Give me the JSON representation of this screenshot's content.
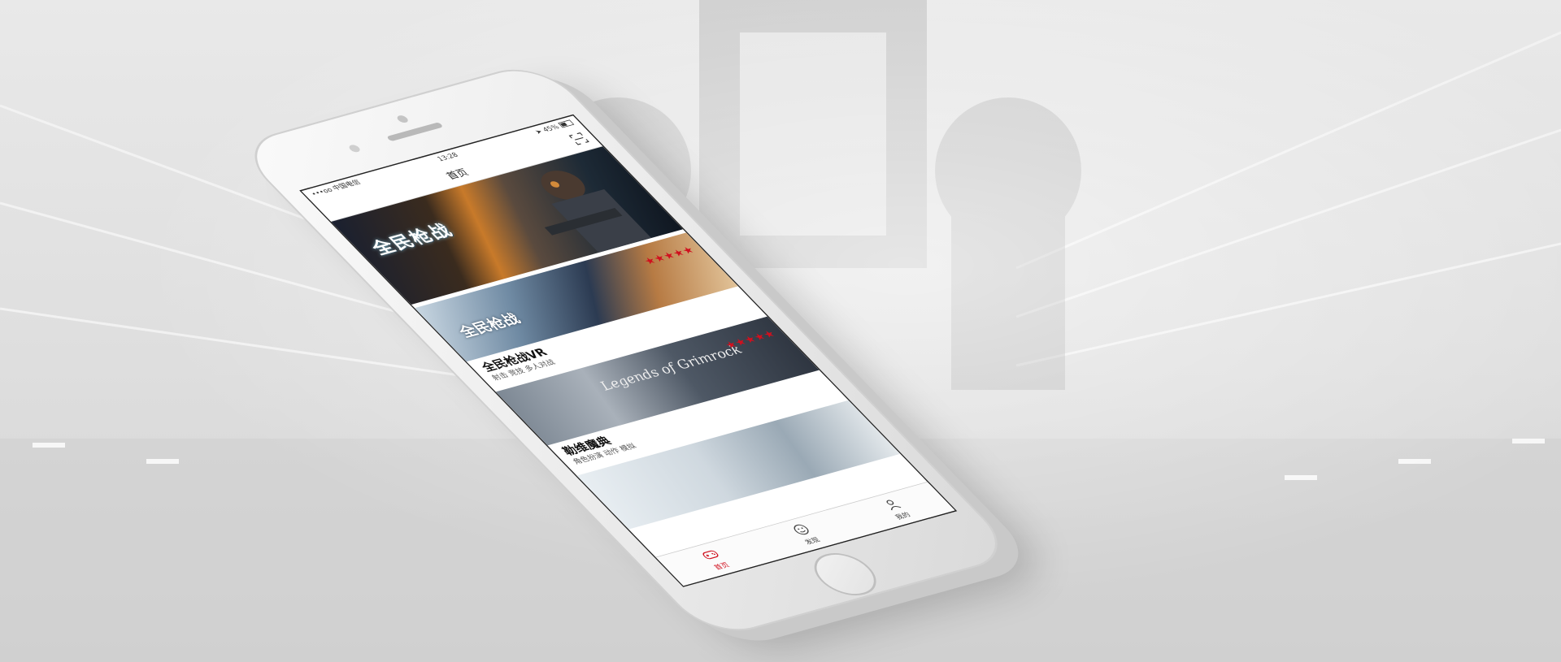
{
  "status_bar": {
    "carrier": "•••oo 中国电信",
    "time": "13:28",
    "battery": "45%"
  },
  "nav": {
    "title": "首页"
  },
  "banner": {
    "logo_text": "全民枪战"
  },
  "games": [
    {
      "logo_text": "全民枪战",
      "title": "全民枪战VR",
      "tags": "射击 竞技 多人对战",
      "stars": "★★★★★",
      "rating_stars": 5
    },
    {
      "logo_text": "Legends of Grimrock",
      "title": "勒维魔典",
      "tags": "角色扮演 动作 模拟",
      "stars": "★★★★★",
      "rating_stars": 5
    }
  ],
  "tabs": [
    {
      "label": "首页",
      "icon": "gamepad-icon",
      "active": true
    },
    {
      "label": "发现",
      "icon": "face-icon",
      "active": false
    },
    {
      "label": "我的",
      "icon": "person-icon",
      "active": false
    }
  ],
  "colors": {
    "accent": "#d0101e",
    "background": "#e4e4e4"
  }
}
